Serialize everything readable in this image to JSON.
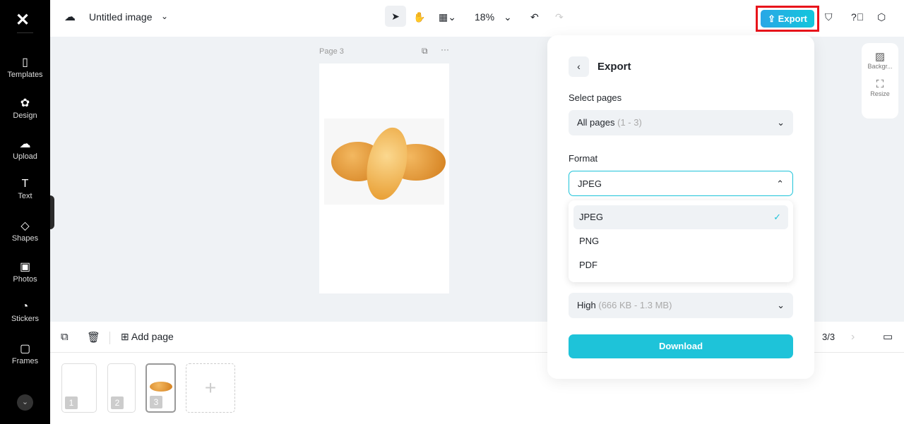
{
  "sidebar": {
    "items": [
      {
        "label": "Templates",
        "icon": "▯"
      },
      {
        "label": "Design",
        "icon": "✿"
      },
      {
        "label": "Upload",
        "icon": "☁"
      },
      {
        "label": "Text",
        "icon": "T"
      },
      {
        "label": "Shapes",
        "icon": "◇"
      },
      {
        "label": "Photos",
        "icon": "▣"
      },
      {
        "label": "Stickers",
        "icon": "◔"
      },
      {
        "label": "Frames",
        "icon": "▢"
      }
    ]
  },
  "header": {
    "title": "Untitled image",
    "zoom": "18%",
    "export_label": "Export"
  },
  "canvas": {
    "page_label": "Page 3"
  },
  "right_panel": {
    "background_label": "Backgr...",
    "resize_label": "Resize"
  },
  "bottom": {
    "add_page": "Add page",
    "page_counter": "3/3",
    "thumbs": [
      "1",
      "2",
      "3"
    ]
  },
  "export_dialog": {
    "title": "Export",
    "select_pages_label": "Select pages",
    "pages_value": "All pages",
    "pages_range": "(1 - 3)",
    "format_label": "Format",
    "format_value": "JPEG",
    "format_options": [
      "JPEG",
      "PNG",
      "PDF"
    ],
    "quality_value": "High",
    "quality_size": "(666 KB - 1.3 MB)",
    "download_label": "Download"
  },
  "colors": {
    "accent": "#1ec3d9",
    "highlight": "#e8141b"
  }
}
